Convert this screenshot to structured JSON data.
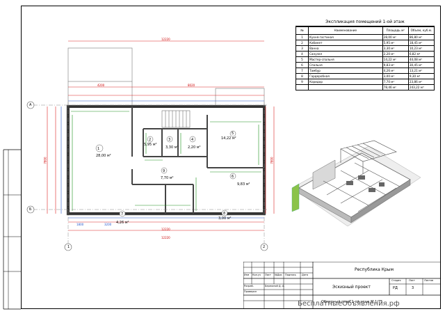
{
  "explication": {
    "title": "Экспликация помещений 1-ой этаж",
    "headers": {
      "num": "№",
      "name": "Наименование",
      "area": "Площадь м²",
      "volume": "Объем, куб.м."
    },
    "rows": [
      {
        "num": "1",
        "name": "Кухня-гостиная",
        "area": "28,00 м²",
        "volume": "86,80 м³"
      },
      {
        "num": "2",
        "name": "Кабинет",
        "area": "5,95 м²",
        "volume": "18,45 м³"
      },
      {
        "num": "3",
        "name": "Ванна",
        "area": "3,30 м²",
        "volume": "10,23 м³"
      },
      {
        "num": "4",
        "name": "Санузел",
        "area": "2,20 м²",
        "volume": "6,82 м³"
      },
      {
        "num": "5",
        "name": "Мастер-спальня",
        "area": "14,22 м²",
        "volume": "44,08 м³"
      },
      {
        "num": "6",
        "name": "Спальня",
        "area": "9,83 м²",
        "volume": "30,45 м³"
      },
      {
        "num": "7",
        "name": "Тамбур",
        "area": "4,26 м²",
        "volume": "13,21 м³"
      },
      {
        "num": "8",
        "name": "Гардеробная",
        "area": "3,00 м²",
        "volume": "9,30 м³"
      },
      {
        "num": "9",
        "name": "Коридор",
        "area": "7,70 м²",
        "volume": "23,86 м³"
      },
      {
        "num": "",
        "name": "",
        "area": "78,46 м²",
        "volume": "243,22 м³"
      }
    ]
  },
  "plan": {
    "rooms": [
      {
        "num": "1",
        "area": "28,00 м²"
      },
      {
        "num": "2",
        "area": "5,95 м²"
      },
      {
        "num": "3",
        "area": "3,30 м²"
      },
      {
        "num": "4",
        "area": "2,20 м²"
      },
      {
        "num": "5",
        "area": "14,22 м²"
      },
      {
        "num": "6",
        "area": "9,83 м²"
      },
      {
        "num": "7",
        "area": "4,26 м²"
      },
      {
        "num": "8",
        "area": "3,00 м²"
      },
      {
        "num": "9",
        "area": "7,70 м²"
      }
    ],
    "axes": {
      "a": "А",
      "b": "Б",
      "one": "1",
      "two": "2"
    },
    "dims": {
      "top_total": "12220",
      "top_a": "4200",
      "top_b": "8020",
      "bottom_total": "12220",
      "bottom_a": "12220",
      "left_total": "7800",
      "right_total": "7800",
      "bottom_seg1": "1800",
      "bottom_seg2": "3200"
    }
  },
  "titleblock": {
    "col_headers": [
      "Изм",
      "Кол.уч",
      "Лист",
      "№Док",
      "Подпись",
      "Дата"
    ],
    "row_label_1": "Разраб.",
    "row_label_2": "Проверил",
    "designer": "Бережной Д. А.",
    "region": "Республика Крым",
    "stage_title": "Эскизный проект",
    "sheet_caption": "Обмерный план 1-ой этаж М 1/75",
    "stage_label": "Стадия",
    "sheet_label": "Лист",
    "sheets_label": "Листов",
    "stage_value": "РД",
    "sheet_value": "3"
  },
  "watermark": "БесплатныеОбъявления.рф"
}
